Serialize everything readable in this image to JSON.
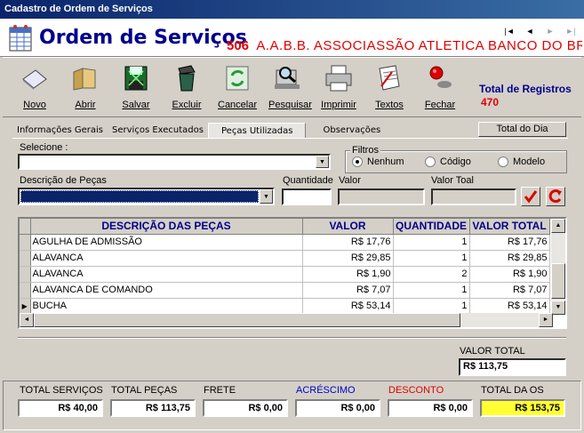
{
  "window": {
    "title": "Cadastro de Ordem de Serviços"
  },
  "header": {
    "title": "Ordem de Serviços",
    "company_code": "506",
    "company_name": "A.A.B.B. ASSOCIASSÃO ATLETICA BANCO DO BRASIL",
    "nav": {
      "first": "|◄",
      "prev": "◄",
      "next": "►",
      "last": "►|"
    }
  },
  "toolbar": {
    "novo": "Novo",
    "abrir": "Abrir",
    "salvar": "Salvar",
    "excluir": "Excluir",
    "cancelar": "Cancelar",
    "pesquisar": "Pesquisar",
    "imprimir": "Imprimir",
    "textos": "Textos",
    "fechar": "Fechar"
  },
  "registros": {
    "label": "Total de Registros",
    "value": "470"
  },
  "tabs": [
    "Informações Gerais",
    "Serviços Executados",
    "Peças Utilizadas",
    "Observações"
  ],
  "active_tab": "Peças Utilizadas",
  "total_dia_button": "Total do Dia",
  "form": {
    "selecione_label": "Selecione :",
    "filtros_label": "Filtros",
    "filtros": [
      "Nenhum",
      "Código",
      "Modelo"
    ],
    "filtro_selected": "Nenhum",
    "descricao_label": "Descrição de Peças",
    "quantidade_label": "Quantidade",
    "valor_label": "Valor",
    "valor_total_label": "Valor Toal"
  },
  "grid": {
    "columns": [
      "DESCRIÇÃO DAS PEÇAS",
      "VALOR",
      "QUANTIDADE",
      "VALOR TOTAL"
    ],
    "rows": [
      {
        "descricao": "AGULHA DE ADMISSÃO",
        "valor": "R$ 17,76",
        "quantidade": "1",
        "total": "R$ 17,76"
      },
      {
        "descricao": "ALAVANCA",
        "valor": "R$ 29,85",
        "quantidade": "1",
        "total": "R$ 29,85"
      },
      {
        "descricao": "ALAVANCA",
        "valor": "R$ 1,90",
        "quantidade": "2",
        "total": "R$ 1,90"
      },
      {
        "descricao": "ALAVANCA DE COMANDO",
        "valor": "R$ 7,07",
        "quantidade": "1",
        "total": "R$ 7,07"
      },
      {
        "descricao": "BUCHA",
        "valor": "R$ 53,14",
        "quantidade": "1",
        "total": "R$ 53,14"
      }
    ],
    "current_row_indicator": "▶"
  },
  "valor_total": {
    "label": "VALOR TOTAL",
    "value": "R$ 113,75"
  },
  "totais": [
    {
      "label": "TOTAL SERVIÇOS",
      "value": "R$ 40,00",
      "color": "#000000",
      "bg": "#ffffff"
    },
    {
      "label": "TOTAL PEÇAS",
      "value": "R$ 113,75",
      "color": "#000000",
      "bg": "#ffffff"
    },
    {
      "label": "FRETE",
      "value": "R$ 0,00",
      "color": "#000000",
      "bg": "#ffffff"
    },
    {
      "label": "ACRÉSCIMO",
      "value": "R$ 0,00",
      "color": "#0000cc",
      "bg": "#ffffff"
    },
    {
      "label": "DESCONTO",
      "value": "R$ 0,00",
      "color": "#e00000",
      "bg": "#ffffff"
    },
    {
      "label": "TOTAL DA OS",
      "value": "R$ 153,75",
      "color": "#000000",
      "bg": "#ffff33"
    }
  ]
}
